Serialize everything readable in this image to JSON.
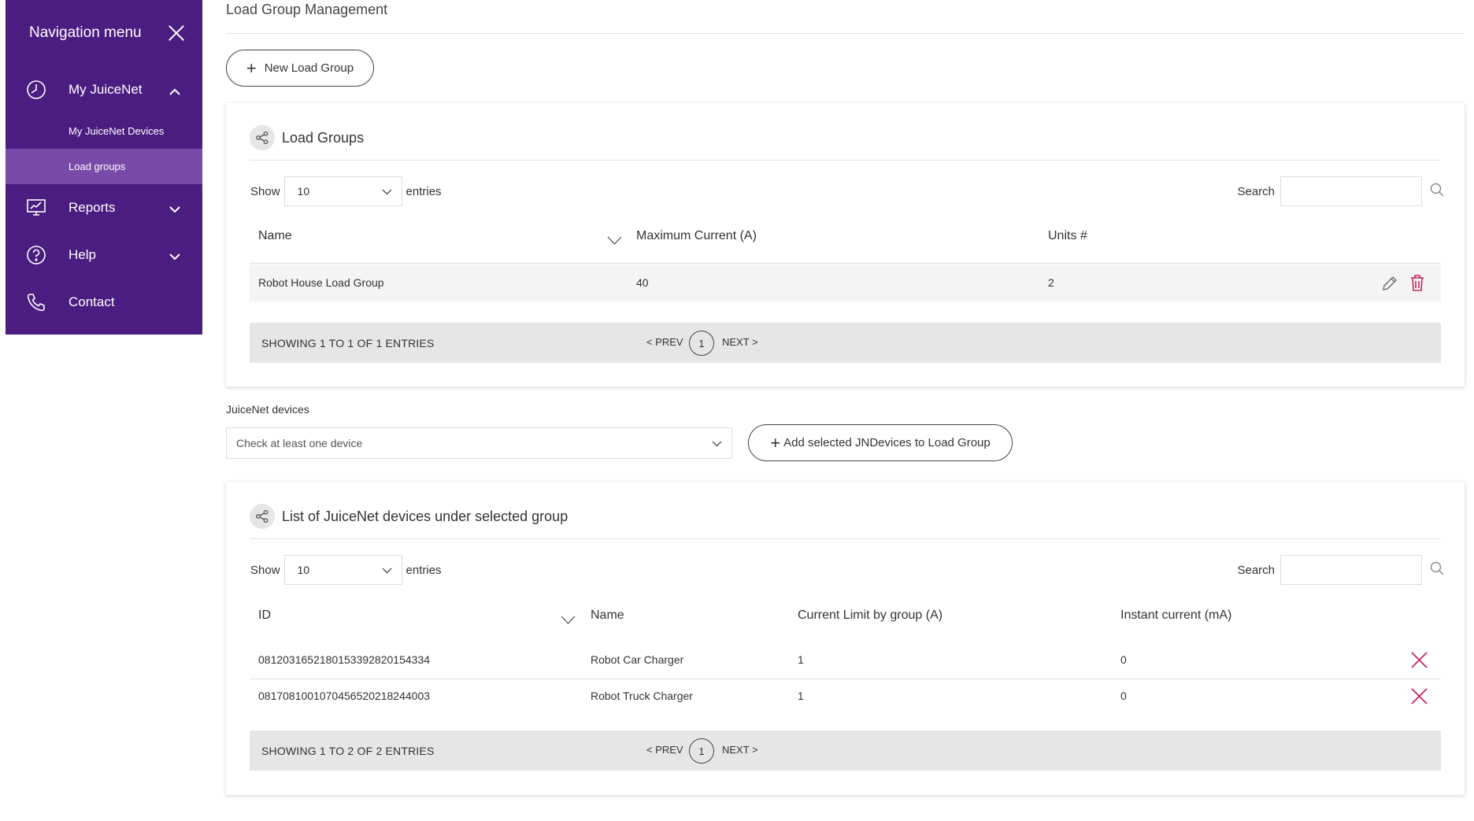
{
  "sidebar": {
    "title": "Navigation menu",
    "items": [
      {
        "label": "My JuiceNet",
        "icon": "dashboard-icon",
        "expanded": true
      },
      {
        "label": "Reports",
        "icon": "monitor-chart-icon",
        "expanded": false
      },
      {
        "label": "Help",
        "icon": "question-icon",
        "expanded": false
      },
      {
        "label": "Contact",
        "icon": "phone-icon"
      }
    ],
    "subitems": [
      {
        "label": "My JuiceNet Devices",
        "active": false
      },
      {
        "label": "Load groups",
        "active": true
      }
    ]
  },
  "page": {
    "title": "Load Group Management"
  },
  "new_group_button": {
    "label": "New Load Group"
  },
  "load_groups": {
    "title": "Load Groups",
    "show_label": "Show",
    "entries_value": "10",
    "entries_label": "entries",
    "search_label": "Search",
    "columns": [
      "Name",
      "Maximum Current (A)",
      "Units #"
    ],
    "rows": [
      {
        "name": "Robot House Load Group",
        "max_current": "40",
        "units": "2"
      }
    ],
    "showing": "SHOWING 1 TO 1 OF 1 ENTRIES",
    "prev": "< PREV",
    "page": "1",
    "next": "NEXT >"
  },
  "devices_select": {
    "label": "JuiceNet devices",
    "placeholder": "Check at least one device",
    "add_button": "Add selected JNDevices to Load Group"
  },
  "device_list": {
    "title": "List of JuiceNet devices under selected group",
    "show_label": "Show",
    "entries_value": "10",
    "entries_label": "entries",
    "search_label": "Search",
    "columns": [
      "ID",
      "Name",
      "Current Limit by group (A)",
      "Instant current (mA)"
    ],
    "rows": [
      {
        "id": "0812031652180153392820154334",
        "name": "Robot Car Charger",
        "limit": "1",
        "instant": "0"
      },
      {
        "id": "0817081001070456520218244003",
        "name": "Robot Truck Charger",
        "limit": "1",
        "instant": "0"
      }
    ],
    "showing": "SHOWING 1 TO 2 OF 2 ENTRIES",
    "prev": "< PREV",
    "page": "1",
    "next": "NEXT >"
  },
  "colors": {
    "sidebar": "#4c1d80",
    "sidebar_active": "#7a4aa8",
    "accent_delete": "#c4275f"
  }
}
